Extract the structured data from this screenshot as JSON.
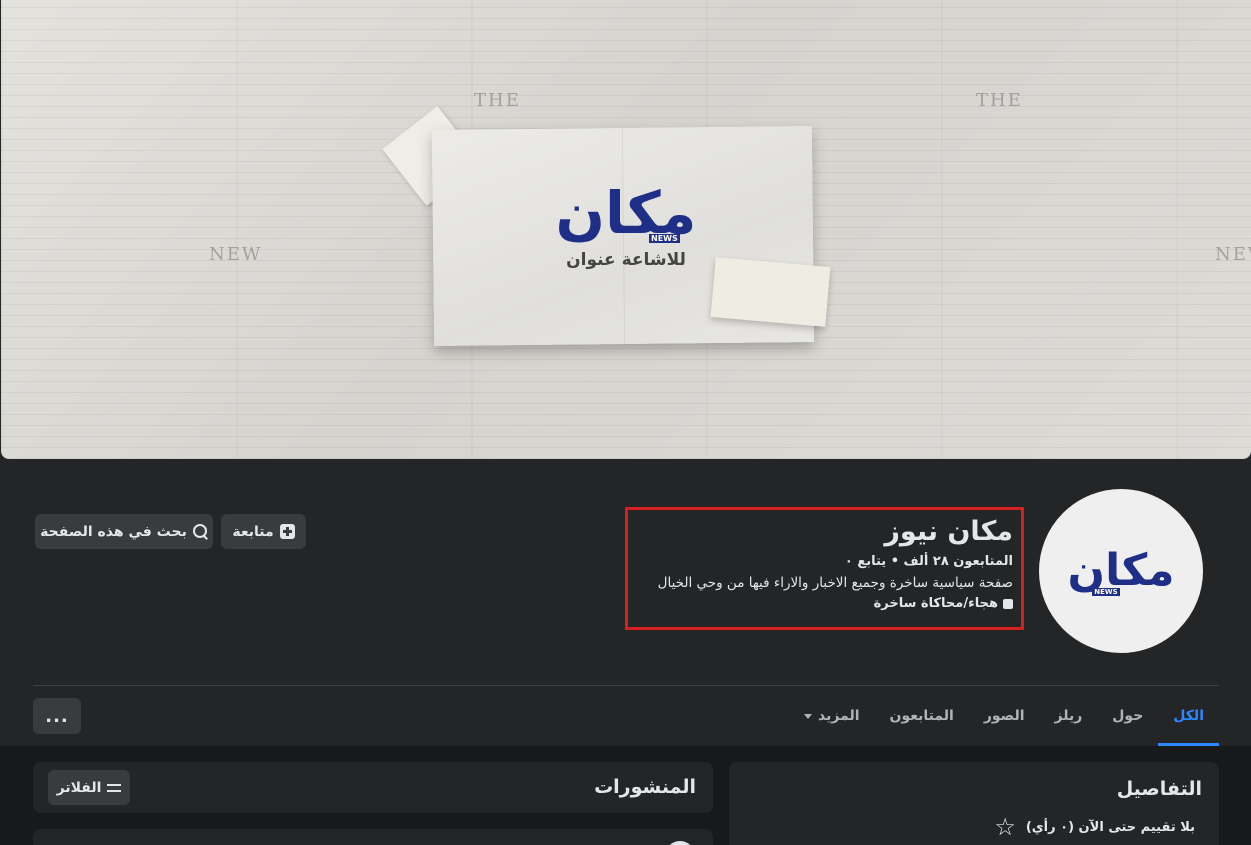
{
  "cover": {
    "logo_text": "مكان",
    "logo_news_tag": "NEWS",
    "tagline": "للاشاعة عنوان",
    "newsprint_words": [
      "THE",
      "NEW",
      "THE",
      "NEW"
    ]
  },
  "profile": {
    "name": "مكان نيوز",
    "followers_line": "المتابعون ٢٨ ألف • يتابع ٠",
    "description": "صفحة سياسية ساخرة وجميع الاخبار والاراء فيها من وحي الخيال",
    "category": "هجاء/محاكاة ساخرة",
    "avatar_logo_text": "مكان",
    "avatar_news_tag": "NEWS",
    "highlight_color": "#d61f1f"
  },
  "actions": {
    "follow_label": "متابعة",
    "search_label": "بحث في هذه الصفحة",
    "more_label": "..."
  },
  "tabs": [
    {
      "label": "الكل",
      "active": true
    },
    {
      "label": "حول",
      "active": false
    },
    {
      "label": "ريلز",
      "active": false
    },
    {
      "label": "الصور",
      "active": false
    },
    {
      "label": "المتابعون",
      "active": false
    },
    {
      "label": "المزيد",
      "active": false
    }
  ],
  "details": {
    "title": "التفاصيل",
    "rating_text": "بلا تقييم حتى الآن (٠ رأي)"
  },
  "posts": {
    "title": "المنشورات",
    "filters_label": "الفلاتر"
  },
  "colors": {
    "accent": "#2d88ff",
    "brand": "#1f2f87",
    "surface": "#242526",
    "background": "#18191a"
  }
}
